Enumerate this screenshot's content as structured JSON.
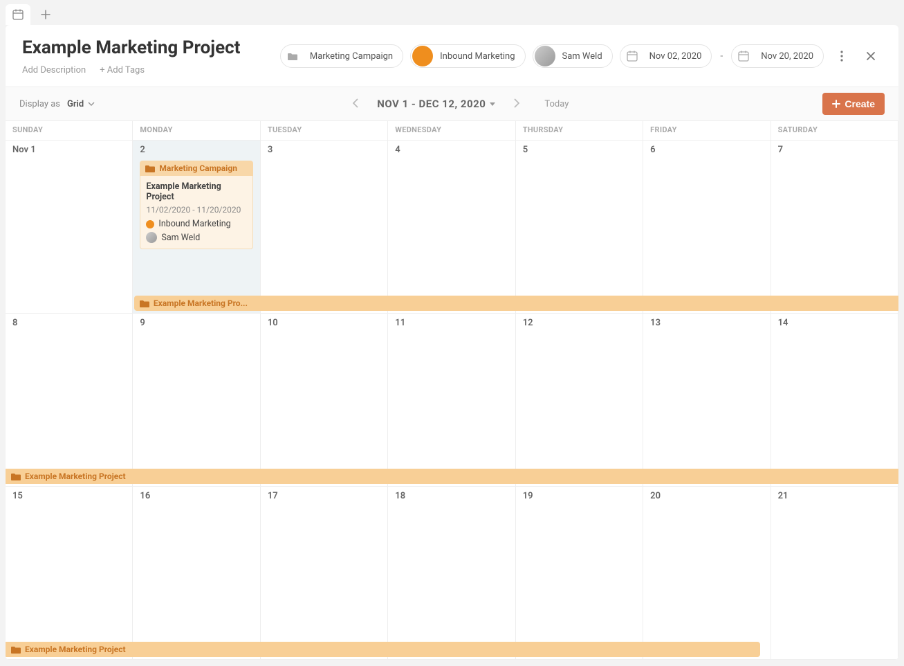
{
  "tabs": {
    "active_icon": "calendar"
  },
  "header": {
    "title": "Example Marketing Project",
    "add_description": "Add Description",
    "add_tags": "+ Add Tags",
    "chips": {
      "campaign": "Marketing Campaign",
      "department": "Inbound Marketing",
      "owner": "Sam Weld",
      "date_start": "Nov 02, 2020",
      "date_end": "Nov 20, 2020",
      "date_dash": "-"
    }
  },
  "toolbar": {
    "display_as_label": "Display as",
    "display_as_value": "Grid",
    "date_range": "NOV 1 - DEC 12, 2020",
    "today": "Today",
    "create_label": "Create"
  },
  "calendar": {
    "day_headers": [
      "SUNDAY",
      "MONDAY",
      "TUESDAY",
      "WEDNESDAY",
      "THURSDAY",
      "FRIDAY",
      "SATURDAY"
    ],
    "weeks": [
      {
        "days": [
          "Nov 1",
          "2",
          "3",
          "4",
          "5",
          "6",
          "7"
        ],
        "today_index": 1
      },
      {
        "days": [
          "8",
          "9",
          "10",
          "11",
          "12",
          "13",
          "14"
        ]
      },
      {
        "days": [
          "15",
          "16",
          "17",
          "18",
          "19",
          "20",
          "21"
        ]
      }
    ],
    "event": {
      "tag": "Marketing Campaign",
      "title": "Example Marketing Project",
      "dates": "11/02/2020 - 11/20/2020",
      "dept": "Inbound Marketing",
      "owner": "Sam Weld"
    },
    "span_bars": {
      "week1_truncated": "Example Marketing Pro...",
      "week2": "Example Marketing Project",
      "week3": "Example Marketing Project"
    }
  },
  "colors": {
    "accent": "#ef8e1e",
    "create": "#d9744b"
  }
}
